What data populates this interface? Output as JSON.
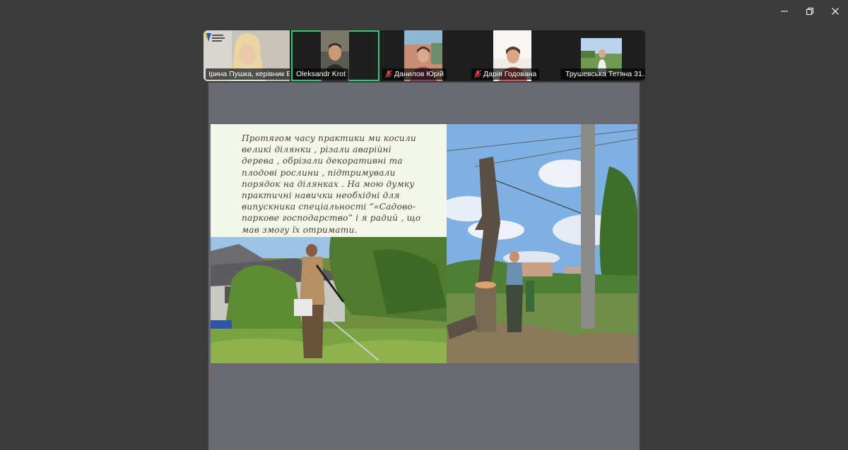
{
  "window": {
    "controls": [
      "minimize",
      "restore",
      "close"
    ]
  },
  "participants": [
    {
      "name": "Ірина Пушка, керівник ЕГ",
      "muted": false,
      "active": false
    },
    {
      "name": "Oleksandr Krot",
      "muted": false,
      "active": true
    },
    {
      "name": "Данилов Юрій",
      "muted": true,
      "active": false
    },
    {
      "name": "Дарія Годована",
      "muted": true,
      "active": false
    },
    {
      "name": "Трушевська Тетяна 31...",
      "muted": true,
      "active": false
    }
  ],
  "slide": {
    "text": "Протягом часу практики ми косили великі ділянки , різали аварійні дерева , обрізали декоративні та плодові рослини , підтримували порядок на ділянках . На мою думку практичні навички необхідні для випускника спеціальності “«Садово-паркове господарство” і я радий , що мав змогу їх отримати."
  },
  "colors": {
    "active_speaker": "#2ecc71",
    "muted": "#e04444",
    "background": "#3b3b3b",
    "share_area": "#6a6a72"
  }
}
